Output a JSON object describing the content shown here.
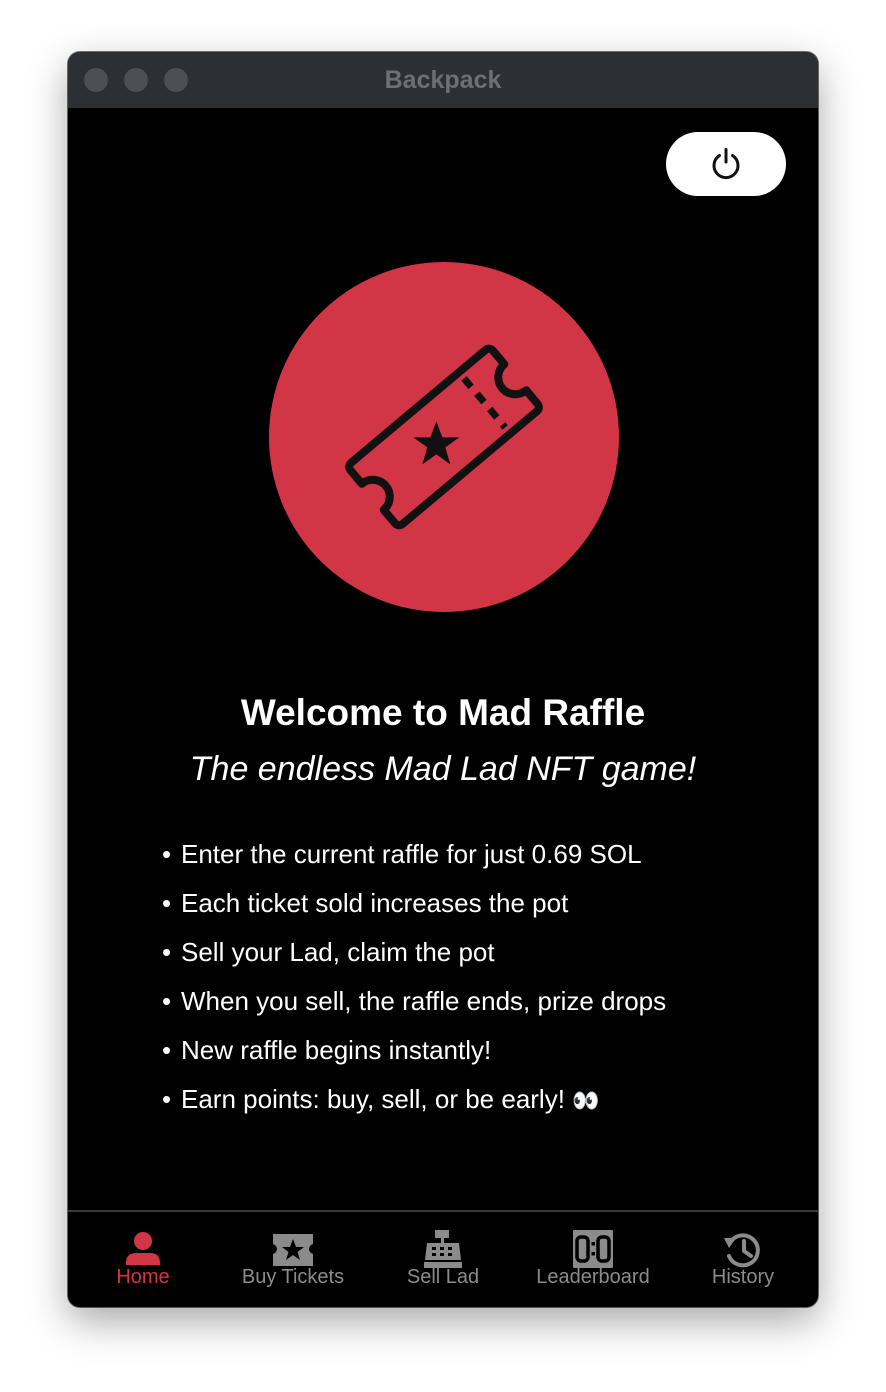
{
  "window": {
    "title": "Backpack"
  },
  "header": {
    "power_icon": "power-icon"
  },
  "hero": {
    "icon": "ticket-star-icon",
    "color": "#d23546"
  },
  "main": {
    "title": "Welcome to Mad Raffle",
    "subtitle": "The endless Mad Lad NFT game!",
    "bullets": [
      "Enter the current raffle for just 0.69 SOL",
      "Each ticket sold increases the pot",
      "Sell your Lad, claim the pot",
      "When you sell, the raffle ends, prize drops",
      "New raffle begins instantly!",
      "Earn points: buy, sell, or be early!"
    ],
    "last_bullet_emoji": "👀"
  },
  "tabs": [
    {
      "label": "Home",
      "icon": "person-icon",
      "active": true
    },
    {
      "label": "Buy Tickets",
      "icon": "ticket-icon",
      "active": false
    },
    {
      "label": "Sell Lad",
      "icon": "cash-register-icon",
      "active": false
    },
    {
      "label": "Leaderboard",
      "icon": "scoreboard-icon",
      "active": false
    },
    {
      "label": "History",
      "icon": "history-icon",
      "active": false
    }
  ],
  "colors": {
    "accent": "#d23546",
    "inactive_tab": "#8b8b8b",
    "background": "#000000"
  }
}
